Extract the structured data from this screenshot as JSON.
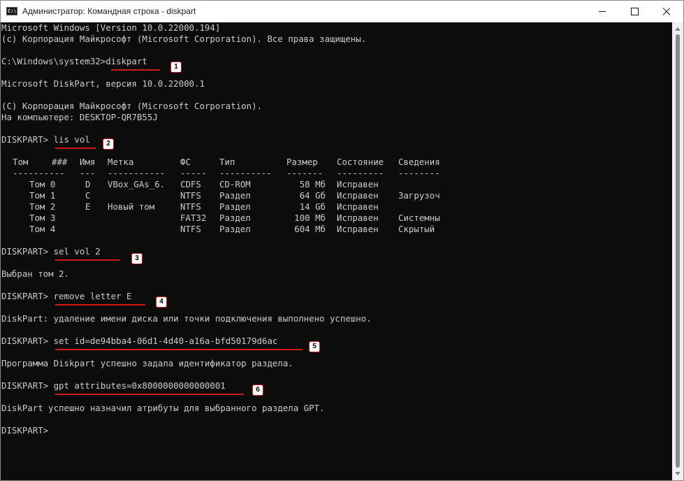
{
  "window": {
    "icon_text": "C:\\",
    "title": "Администратор: Командная строка - diskpart",
    "icons": {
      "app": "cmd-icon",
      "minimize": "minimize-icon",
      "maximize": "maximize-icon",
      "close": "close-icon"
    }
  },
  "console": {
    "lines": [
      "Microsoft Windows [Version 10.0.22000.194]",
      "(c) Корпорация Майкрософт (Microsoft Corporation). Все права защищены.",
      "",
      "C:\\Windows\\system32>diskpart",
      "",
      "Microsoft DiskPart, версия 10.0.22000.1",
      "",
      "(C) Корпорация Майкрософт (Microsoft Corporation).",
      "На компьютере: DESKTOP-QR7B55J",
      "",
      "DISKPART> lis vol",
      "",
      "",
      "",
      "",
      "",
      "",
      "",
      "",
      "",
      "DISKPART> sel vol 2",
      "",
      "Выбран том 2.",
      "",
      "DISKPART> remove letter E",
      "",
      "DiskPart: удаление имени диска или точки подключения выполнено успешно.",
      "",
      "DISKPART> set id=de94bba4-06d1-4d40-a16a-bfd50179d6ac",
      "",
      "Программа Diskpart успешно задала идентификатор раздела.",
      "",
      "DISKPART> gpt attributes=0x8000000000000001",
      "",
      "DiskPart успешно назначил атрибуты для выбранного раздела GPT.",
      "",
      "DISKPART>"
    ],
    "volume_table": {
      "headers": [
        "Том",
        "###",
        "Имя",
        "Метка",
        "ФС",
        "Тип",
        "Размер",
        "Состояние",
        "Сведения"
      ],
      "separators": [
        "----------",
        "---",
        "-----------",
        "-----",
        "----------",
        "-------",
        "---------",
        "--------"
      ],
      "rows": [
        [
          "Том 0",
          "D",
          "VBox_GAs_6.",
          "CDFS",
          "CD-ROM",
          "58 Мб",
          "Исправен",
          ""
        ],
        [
          "Том 1",
          "C",
          "",
          "NTFS",
          "Раздел",
          "64 Gб",
          "Исправен",
          "Загрузоч"
        ],
        [
          "Том 2",
          "E",
          "Новый том",
          "NTFS",
          "Раздел",
          "14 Gб",
          "Исправен",
          ""
        ],
        [
          "Том 3",
          "",
          "",
          "FAT32",
          "Раздел",
          "100 Мб",
          "Исправен",
          "Системны"
        ],
        [
          "Том 4",
          "",
          "",
          "NTFS",
          "Раздел",
          "604 Мб",
          "Исправен",
          "Скрытый"
        ]
      ]
    }
  },
  "annotations": [
    {
      "number": "1",
      "color": "#d11b16"
    },
    {
      "number": "2",
      "color": "#d11b16"
    },
    {
      "number": "3",
      "color": "#d11b16"
    },
    {
      "number": "4",
      "color": "#d11b16"
    },
    {
      "number": "5",
      "color": "#d11b16"
    },
    {
      "number": "6",
      "color": "#d11b16"
    }
  ],
  "colors": {
    "console_bg": "#0c0c0c",
    "console_text": "#cccccc",
    "annotation": "#d11b16"
  }
}
